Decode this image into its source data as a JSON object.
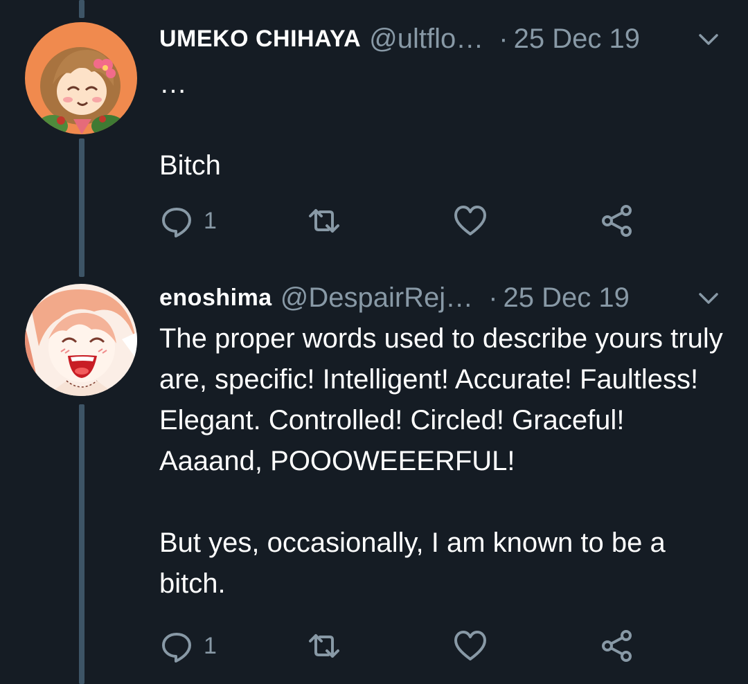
{
  "tweets": [
    {
      "display_name": "UMEKO CHIHAYA",
      "handle": "@ultflo…",
      "separator": "·",
      "date": "25 Dec 19",
      "text": "…\n\nBitch",
      "reply_count": "1",
      "avatar_icon": "avatar-umeko-icon"
    },
    {
      "display_name": "enoshima",
      "handle": "@DespairRej…",
      "separator": "·",
      "date": "25 Dec 19",
      "text": "The proper words used to describe yours truly are, specific! Intelligent! Accurate! Faultless! Elegant. Controlled! Circled! Graceful! Aaaand, POOOWEEERFUL!\n\nBut yes, occasionally, I am known to be a bitch.",
      "reply_count": "1",
      "avatar_icon": "avatar-enoshima-icon"
    }
  ],
  "colors": {
    "background": "#151c24",
    "thread_line": "#3d5466",
    "secondary_text": "#8899a6",
    "primary_text": "#ffffff"
  },
  "icons": [
    "reply-icon",
    "retweet-icon",
    "like-icon",
    "share-icon",
    "chevron-down-icon"
  ]
}
